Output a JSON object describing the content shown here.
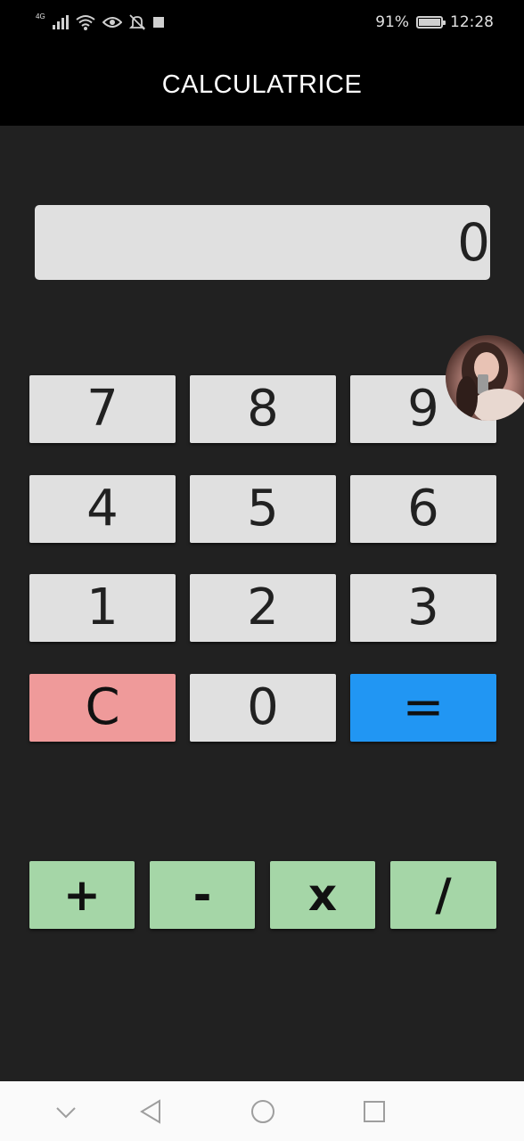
{
  "status_bar": {
    "network": "4G",
    "battery_percent": "91%",
    "time": "12:28",
    "battery_level": 0.91
  },
  "app_bar": {
    "title": "CALCULATRICE"
  },
  "display": {
    "value": "0"
  },
  "keypad": {
    "rows": [
      [
        "7",
        "8",
        "9"
      ],
      [
        "4",
        "5",
        "6"
      ],
      [
        "1",
        "2",
        "3"
      ],
      [
        "C",
        "0",
        "="
      ]
    ]
  },
  "operators": [
    "+",
    "-",
    "x",
    "/"
  ],
  "colors": {
    "background": "#212121",
    "app_bar": "#000000",
    "number_key": "#e0e0e0",
    "clear_key": "#ef9a9a",
    "equals_key": "#2196f3",
    "operator_key": "#a5d6a7",
    "navigation_bar": "#fafafa"
  },
  "icons": {
    "status_left": [
      "signal-icon",
      "wifi-icon",
      "eye-icon",
      "bell-off-icon",
      "square-notification-icon"
    ],
    "status_right": [
      "battery-icon"
    ],
    "overlay": "chat-head-avatar",
    "navigation": [
      "collapse-chevron-icon",
      "back-icon",
      "home-icon",
      "recents-icon"
    ]
  }
}
